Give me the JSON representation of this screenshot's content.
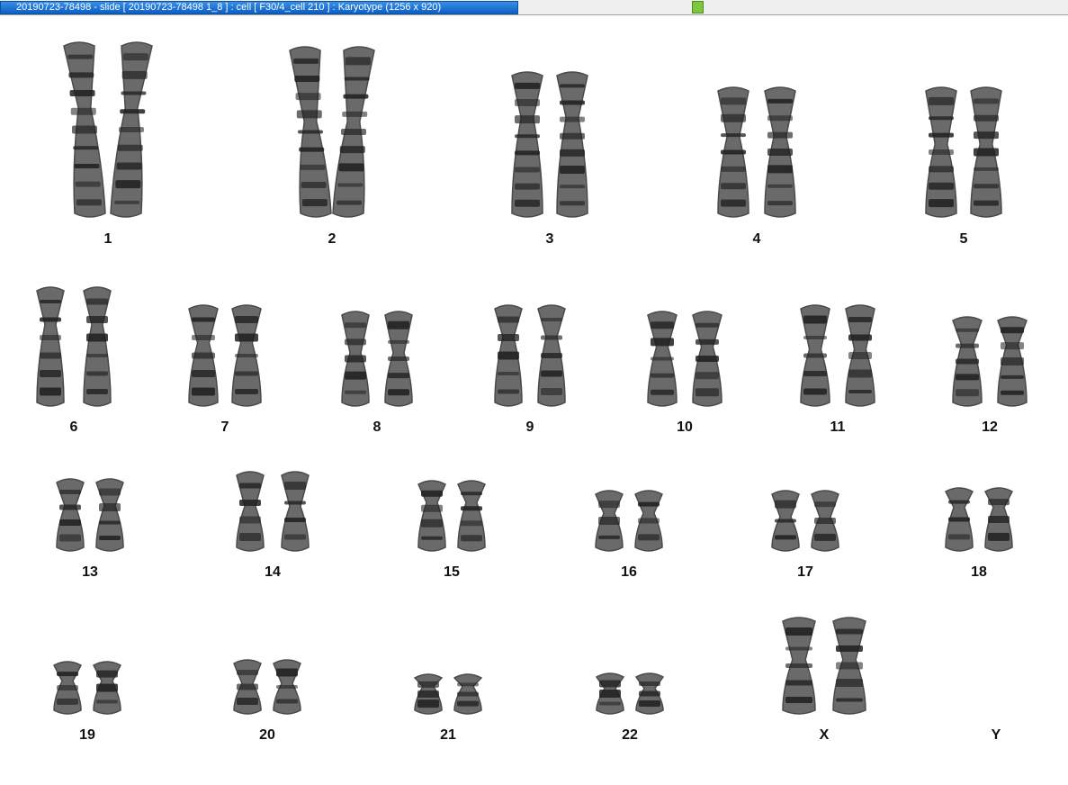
{
  "window": {
    "title": "20190723-78498 - slide [ 20190723-78498 1_8 ] : cell [ F30/4_cell 210 ] : Karyotype  (1256 x 920)",
    "status_color": "#7ec83f"
  },
  "karyotype": {
    "labels": [
      "1",
      "2",
      "3",
      "4",
      "5",
      "6",
      "7",
      "8",
      "9",
      "10",
      "11",
      "12",
      "13",
      "14",
      "15",
      "16",
      "17",
      "18",
      "19",
      "20",
      "21",
      "22",
      "X",
      "Y"
    ],
    "chromosome_color": "#1e1e1e"
  }
}
